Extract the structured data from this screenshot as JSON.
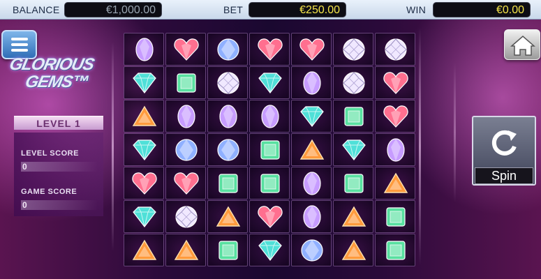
{
  "topbar": {
    "balance_label": "BALANCE",
    "balance_value": "€1,000.00",
    "bet_label": "BET",
    "bet_value": "€250.00",
    "win_label": "WIN",
    "win_value": "€0.00"
  },
  "logo": {
    "line1": "GLORIOUS",
    "line2": "GEMS™"
  },
  "panel": {
    "level": "LEVEL 1",
    "level_score_label": "LEVEL SCORE",
    "level_score_value": "0",
    "game_score_label": "GAME SCORE",
    "game_score_value": "0"
  },
  "spin": {
    "label": "Spin"
  },
  "icons": {
    "menu": "menu-icon",
    "home": "home-icon",
    "spin": "refresh-icon"
  },
  "gem_colors": {
    "heart": "#ff6f8f",
    "teal-diamond": "#4fe0d8",
    "round-white": "#f0e8ff",
    "emerald": "#58e0a0",
    "triangle": "#ff9a3c",
    "violet-oval": "#c79cff",
    "blue-round": "#8fb0ff"
  },
  "grid": [
    [
      "violet-oval",
      "heart",
      "blue-round",
      "heart",
      "heart",
      "round-white",
      "round-white"
    ],
    [
      "teal-diamond",
      "emerald",
      "round-white",
      "teal-diamond",
      "violet-oval",
      "round-white",
      "heart"
    ],
    [
      "triangle",
      "violet-oval",
      "violet-oval",
      "violet-oval",
      "teal-diamond",
      "emerald",
      "heart"
    ],
    [
      "teal-diamond",
      "blue-round",
      "blue-round",
      "emerald",
      "triangle",
      "teal-diamond",
      "violet-oval"
    ],
    [
      "heart",
      "heart",
      "emerald",
      "emerald",
      "violet-oval",
      "emerald",
      "triangle"
    ],
    [
      "teal-diamond",
      "round-white",
      "triangle",
      "heart",
      "violet-oval",
      "triangle",
      "emerald"
    ],
    [
      "triangle",
      "triangle",
      "emerald",
      "teal-diamond",
      "blue-round",
      "triangle",
      "emerald"
    ]
  ]
}
